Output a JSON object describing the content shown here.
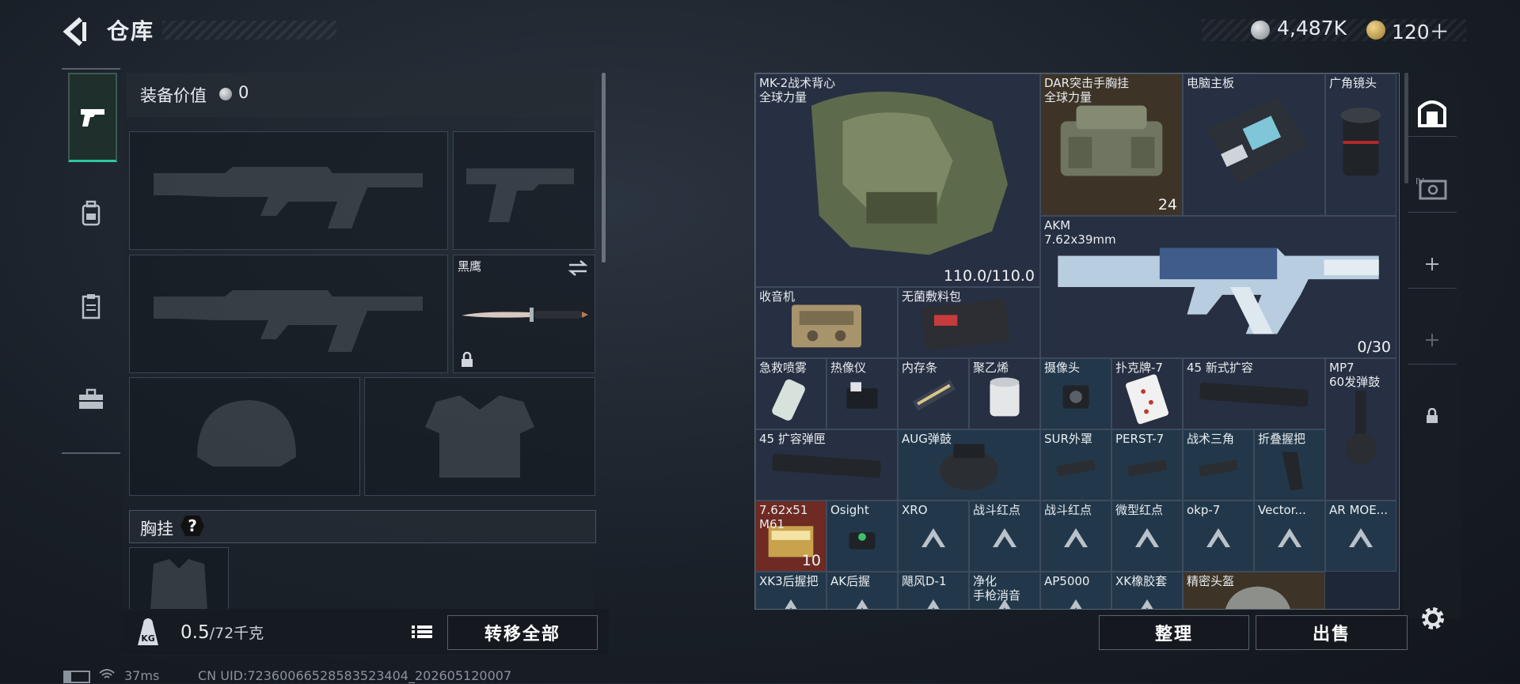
{
  "header": {
    "title": "仓库",
    "currency_silver": "4,487K",
    "currency_gold": "120＋"
  },
  "left": {
    "equip_value_label": "装备价值",
    "equip_value": "0",
    "knife_slot_label": "黑鹰",
    "chest_rig_label": "胸挂",
    "help_label": "?",
    "weight_value": "0.5",
    "weight_capacity": "/72千克",
    "transfer_all_label": "转移全部"
  },
  "grid": {
    "items": [
      {
        "name": "MK-2战术背心\n全球力量",
        "br": "110.0/110.0"
      },
      {
        "name": "DAR突击手胸挂\n全球力量",
        "br": "24"
      },
      {
        "name": "电脑主板"
      },
      {
        "name": "广角镜头"
      },
      {
        "name": "AKM\n7.62x39mm",
        "br": "0/30"
      },
      {
        "name": "收音机"
      },
      {
        "name": "无菌敷料包"
      },
      {
        "name": "急救喷雾"
      },
      {
        "name": "热像仪"
      },
      {
        "name": "内存条"
      },
      {
        "name": "聚乙烯"
      },
      {
        "name": "摄像头"
      },
      {
        "name": "扑克牌-7"
      },
      {
        "name": "45 新式扩容"
      },
      {
        "name": "MP7\n60发弹鼓"
      },
      {
        "name": "45 扩容弹匣"
      },
      {
        "name": "AUG弹鼓"
      },
      {
        "name": "SUR外罩"
      },
      {
        "name": "PERST-7"
      },
      {
        "name": "战术三角"
      },
      {
        "name": "折叠握把"
      },
      {
        "name": "7.62x51\nM61",
        "br": "10"
      },
      {
        "name": "Osight"
      },
      {
        "name": "XRO"
      },
      {
        "name": "战斗红点"
      },
      {
        "name": "战斗红点"
      },
      {
        "name": "微型红点"
      },
      {
        "name": "okp-7"
      },
      {
        "name": "Vector..."
      },
      {
        "name": "AR MOE..."
      },
      {
        "name": "XK3后握把"
      },
      {
        "name": "AK后握"
      },
      {
        "name": "飓风D-1"
      },
      {
        "name": "净化\n手枪消音"
      },
      {
        "name": "AP5000"
      },
      {
        "name": "XK橡胶套"
      },
      {
        "name": "精密头盔"
      }
    ]
  },
  "footer": {
    "sort_label": "整理",
    "sell_label": "出售",
    "ping": "37ms",
    "uid": "CN UID:72360066528583523404_202605120007"
  }
}
